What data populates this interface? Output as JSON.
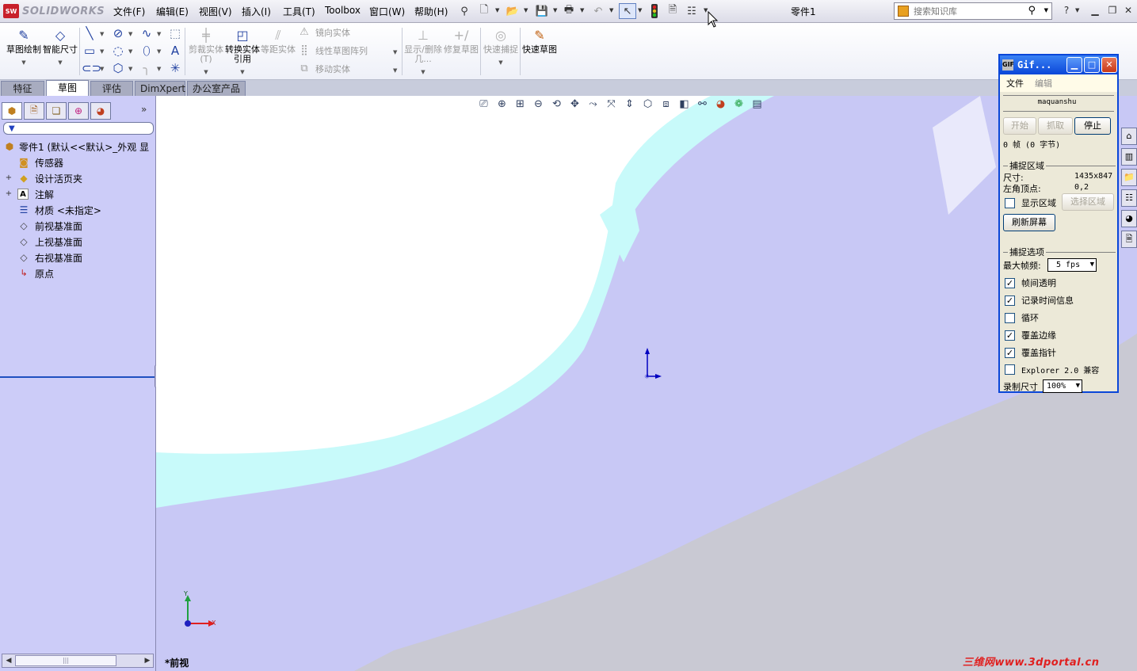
{
  "app": {
    "logo_text": "SOLIDWORKS",
    "document_title": "零件1"
  },
  "menu": [
    "文件(F)",
    "编辑(E)",
    "视图(V)",
    "插入(I)",
    "工具(T)",
    "Toolbox",
    "窗口(W)",
    "帮助(H)"
  ],
  "search": {
    "placeholder": "搜索知识库"
  },
  "ribbon": {
    "sketch": "草图绘制",
    "smart_dim": "智能尺寸",
    "trim": "剪裁实体(T)",
    "convert": "转换实体引用",
    "offset": "等距实体",
    "mirror": "镜向实体",
    "linear_pattern": "线性草图阵列",
    "move": "移动实体",
    "display_relations": "显示/删除几...",
    "repair": "修复草图",
    "quick_snap": "快速捕捉",
    "rapid_sketch": "快速草图"
  },
  "tabs": [
    "特征",
    "草图",
    "评估",
    "DimXpert",
    "办公室产品"
  ],
  "active_tab": "草图",
  "tree": {
    "root": "零件1 (默认<<默认>_外观 显",
    "items": [
      "传感器",
      "设计活页夹",
      "注解",
      "材质 <未指定>",
      "前视基准面",
      "上视基准面",
      "右视基准面",
      "原点"
    ]
  },
  "viewport": {
    "view_name": "*前视",
    "watermark": "三维网www.3dportal.cn",
    "triad_y": "Y",
    "triad_x": "X"
  },
  "gif": {
    "title": "Gif...",
    "menu": [
      "文件",
      "编辑"
    ],
    "name": "maquanshu",
    "btn_start": "开始",
    "btn_grab": "抓取",
    "btn_stop": "停止",
    "frames": "0 帧 (0 字节)",
    "capture_area": "捕捉区域",
    "size_label": "尺寸:",
    "size_value": "1435x847",
    "corner_label": "左角顶点:",
    "corner_value": "0,2",
    "show_area": "显示区域",
    "select_area": "选择区域",
    "refresh": "刷新屏幕",
    "capture_options": "捕捉选项",
    "max_fps_label": "最大帧频:",
    "max_fps_value": "5 fps",
    "opt_transparent": "帧间透明",
    "opt_timing": "记录时间信息",
    "opt_loop": "循环",
    "opt_border": "覆盖边缘",
    "opt_cursor": "覆盖指针",
    "opt_explorer": "Explorer 2.0 兼容",
    "rec_size_label": "录制尺寸",
    "rec_size_value": "100%"
  },
  "colors": {
    "viewport_base": "#c9c9d3",
    "viewport_lavender": "#c8c8f5",
    "viewport_cyan": "#c8fafa",
    "panel_bg": "#ccccf8",
    "gif_title": "#0a46d8"
  }
}
